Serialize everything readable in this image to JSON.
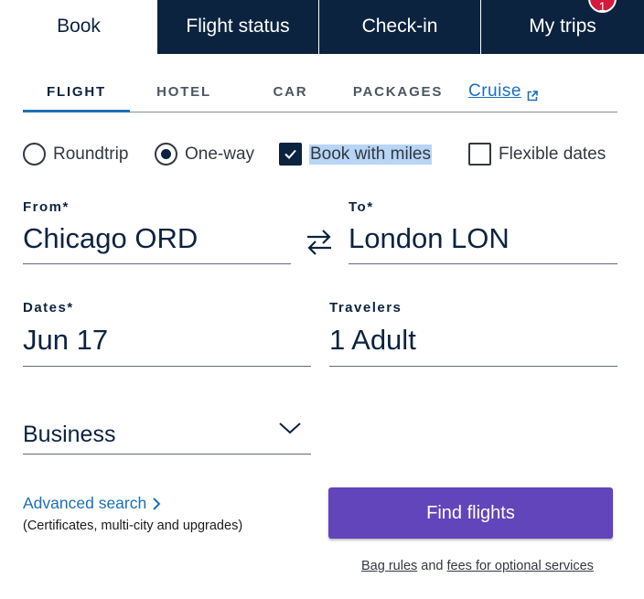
{
  "top_tabs": {
    "book": "Book",
    "flight_status": "Flight status",
    "check_in": "Check-in",
    "my_trips": "My trips",
    "my_trips_badge": "1"
  },
  "product_tabs": {
    "flight": "FLIGHT",
    "hotel": "HOTEL",
    "car": "CAR",
    "packages": "PACKAGES",
    "cruise": "Cruise"
  },
  "options": {
    "roundtrip": "Roundtrip",
    "one_way": "One-way",
    "book_with_miles": "Book with miles",
    "flexible_dates": "Flexible dates",
    "selected_trip_type": "One-way",
    "book_with_miles_checked": true,
    "flexible_dates_checked": false
  },
  "fields": {
    "from_label": "From*",
    "from_value": "Chicago ORD",
    "to_label": "To*",
    "to_value": "London LON",
    "dates_label": "Dates*",
    "dates_value": "Jun 17",
    "travelers_label": "Travelers",
    "travelers_value": "1 Adult",
    "cabin_value": "Business"
  },
  "advanced": {
    "link": "Advanced search",
    "subtext": "(Certificates, multi-city and upgrades)"
  },
  "find_flights": "Find flights",
  "footer": {
    "bag_rules": "Bag rules",
    "and": " and ",
    "fees": "fees for optional services"
  },
  "colors": {
    "navy": "#0c2340",
    "link_blue": "#1a6fba",
    "button_purple": "#6244bb",
    "badge_red": "#d51a3c",
    "selection_highlight": "#b8d5f6"
  }
}
